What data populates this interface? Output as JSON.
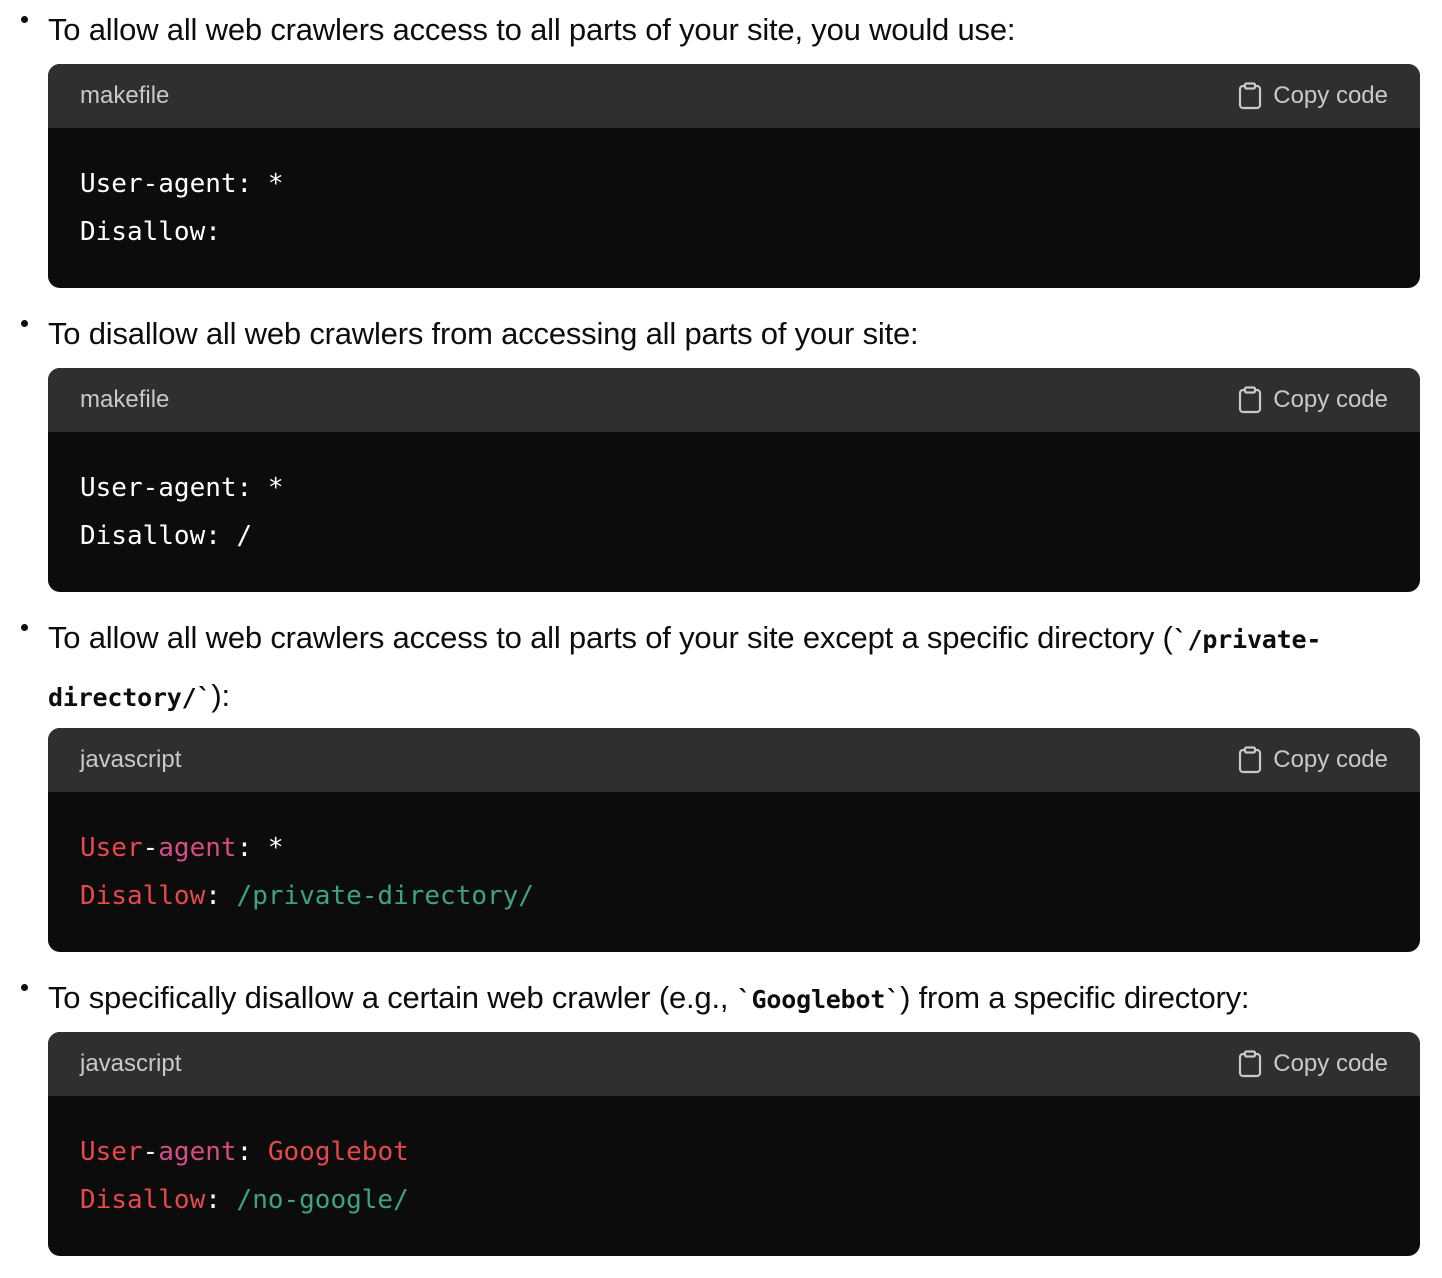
{
  "copy_label": "Copy code",
  "items": [
    {
      "text": "To allow all web crawlers access to all parts of your site, you would use:",
      "lang": "makefile",
      "code": {
        "line1": "User-agent: *",
        "line2": "Disallow:"
      }
    },
    {
      "text": "To disallow all web crawlers from accessing all parts of your site:",
      "lang": "makefile",
      "code": {
        "line1": "User-agent: *",
        "line2": "Disallow: /"
      }
    },
    {
      "text_before": "To allow all web crawlers access to all parts of your site except a specific directory (",
      "inline_code": "`/private-directory/`",
      "text_after": "):",
      "lang": "javascript",
      "code": {
        "l1_key_a": "User",
        "l1_dash": "-",
        "l1_key_b": "agent",
        "l1_colon": ":",
        "l1_value": " *",
        "l2_key": "Disallow",
        "l2_colon": ":",
        "l2_value": " /private-directory/"
      }
    },
    {
      "text_before": "To specifically disallow a certain web crawler (e.g., ",
      "inline_code": "`Googlebot`",
      "text_after": ") from a specific directory:",
      "lang": "javascript",
      "code": {
        "l1_key_a": "User",
        "l1_dash": "-",
        "l1_key_b": "agent",
        "l1_colon": ":",
        "l1_value": " Googlebot",
        "l2_key": "Disallow",
        "l2_colon": ":",
        "l2_value": " /no-google/"
      }
    }
  ]
}
